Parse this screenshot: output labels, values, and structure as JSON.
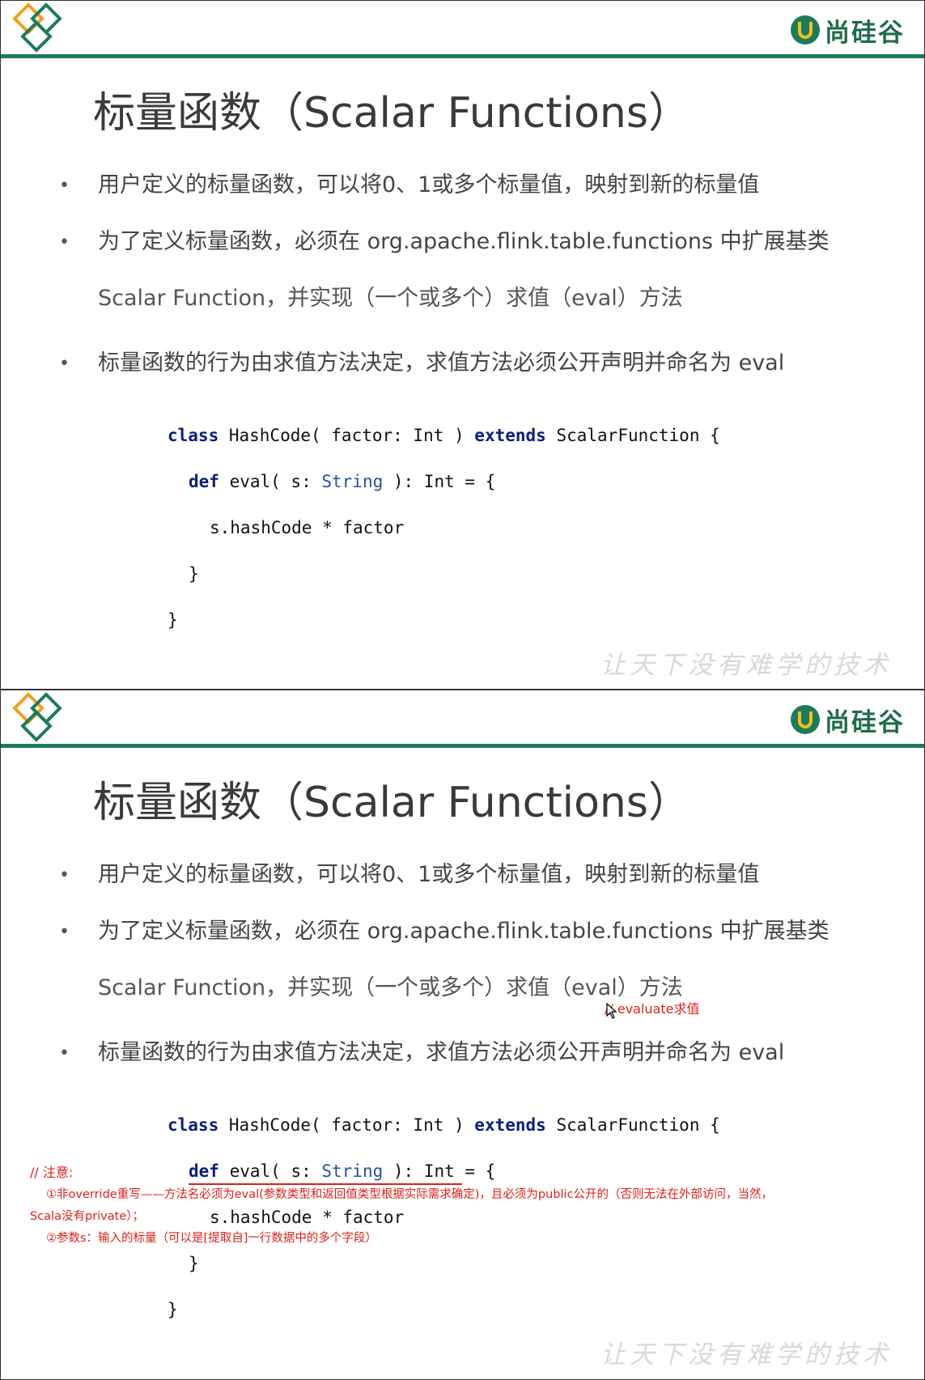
{
  "slides": [
    {
      "brand": "尚硅谷",
      "title": "标量函数（Scalar Functions）",
      "bullets": [
        "用户定义的标量函数，可以将0、1或多个标量值，映射到新的标量值",
        "为了定义标量函数，必须在 org.apache.flink.table.functions 中扩展基类",
        "Scalar Function，并实现（一个或多个）求值（eval）方法",
        "标量函数的行为由求值方法决定，求值方法必须公开声明并命名为 eval"
      ],
      "code": {
        "line1_kw": "class",
        "line1_rest": " HashCode( factor: Int ) ",
        "line1_kw2": "extends",
        "line1_end": " ScalarFunction {",
        "line2_kw": "def",
        "line2_a": " eval( s: ",
        "line2_type": "String",
        "line2_b": " ): Int = {",
        "line3": "s.hashCode * factor",
        "line4": "}",
        "line5": "}"
      },
      "watermark": "让天下没有难学的技术"
    },
    {
      "brand": "尚硅谷",
      "title": "标量函数（Scalar Functions）",
      "bullets": [
        "用户定义的标量函数，可以将0、1或多个标量值，映射到新的标量值",
        "为了定义标量函数，必须在 org.apache.flink.table.functions 中扩展基类",
        "Scalar Function，并实现（一个或多个）求值（eval）方法",
        "标量函数的行为由求值方法决定，求值方法必须公开声明并命名为 eval"
      ],
      "code": {
        "line1_kw": "class",
        "line1_rest": " HashCode( factor: Int ) ",
        "line1_kw2": "extends",
        "line1_end": " ScalarFunction {",
        "line2_kw": "def",
        "line2_a": " eval( s: ",
        "line2_type": "String",
        "line2_b": " ): Int = {",
        "line3": "s.hashCode * factor",
        "line4": "}",
        "line5": "}"
      },
      "watermark": "让天下没有难学的技术",
      "annotations": {
        "eval_note": "// evaluate求值",
        "note_heading": "// 注意:",
        "note_1a": "①非override重写——方法名必须为eval(参数类型和返回值类型根据实际需求确定)，且必须为public公开的（否则无法在外部访问，当然，",
        "note_1b": "Scala没有private）；",
        "note_2": "②参数s：输入的标量（可以是[提取自]一行数据中的多个字段）"
      }
    }
  ],
  "colors": {
    "brand_green": "#1f7a5a",
    "logo_orange": "#f0a020",
    "annotation_red": "#e0201a",
    "keyword_navy": "#0b1f7a"
  }
}
